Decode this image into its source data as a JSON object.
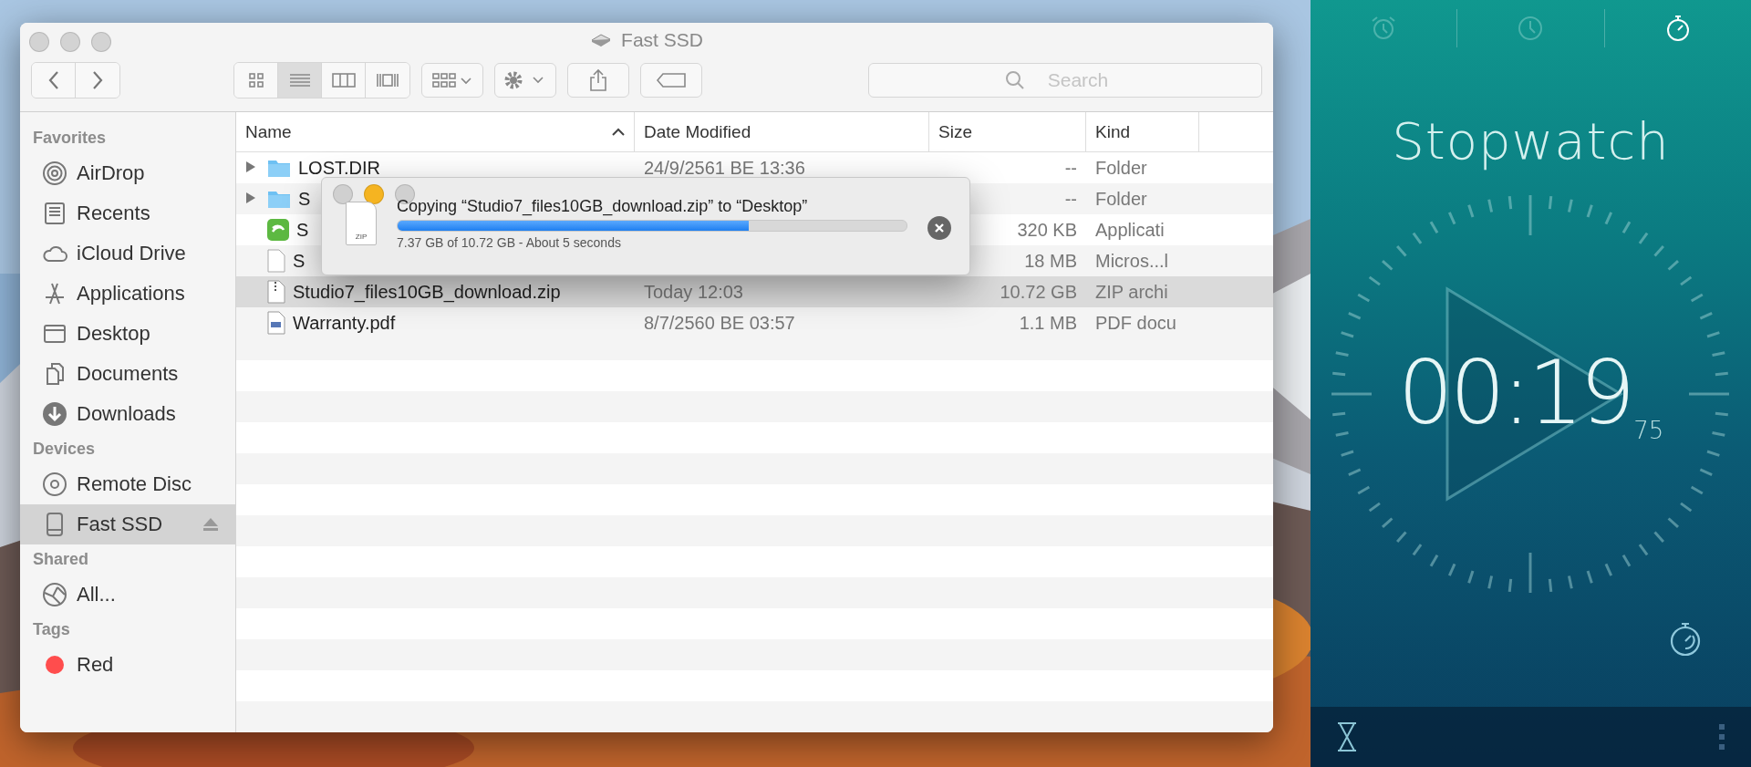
{
  "finder": {
    "title": "Fast SSD",
    "view_modes": [
      {
        "kind": "icons",
        "selected": false
      },
      {
        "kind": "list",
        "selected": true
      },
      {
        "kind": "columns",
        "selected": false
      },
      {
        "kind": "gallery",
        "selected": false
      }
    ],
    "search": {
      "placeholder": "Search"
    },
    "sidebar": [
      {
        "title": "Favorites",
        "items": [
          {
            "label": "AirDrop",
            "kind": "airdrop",
            "selected": false
          },
          {
            "label": "Recents",
            "kind": "recents",
            "selected": false
          },
          {
            "label": "iCloud Drive",
            "kind": "cloud",
            "selected": false
          },
          {
            "label": "Applications",
            "kind": "apps",
            "selected": false
          },
          {
            "label": "Desktop",
            "kind": "desktop",
            "selected": false
          },
          {
            "label": "Documents",
            "kind": "documents",
            "selected": false
          },
          {
            "label": "Downloads",
            "kind": "downloads",
            "selected": false
          }
        ]
      },
      {
        "title": "Devices",
        "items": [
          {
            "label": "Remote Disc",
            "kind": "disc",
            "selected": false
          },
          {
            "label": "Fast SSD",
            "kind": "drive",
            "selected": true,
            "ejectable": true
          }
        ]
      },
      {
        "title": "Shared",
        "items": [
          {
            "label": "All...",
            "kind": "network",
            "selected": false
          }
        ]
      },
      {
        "title": "Tags",
        "items": [
          {
            "label": "Red",
            "kind": "tag",
            "color": "#ff4d4d",
            "selected": false
          }
        ]
      }
    ],
    "columns": [
      {
        "label": "Name",
        "sorted": true
      },
      {
        "label": "Date Modified",
        "sorted": false
      },
      {
        "label": "Size",
        "sorted": false
      },
      {
        "label": "Kind",
        "sorted": false
      }
    ],
    "rows": [
      {
        "kind": "folder",
        "expandable": true,
        "selected": false,
        "name": "LOST.DIR",
        "date": "24/9/2561 BE 13:36",
        "size": "--",
        "file_kind": "Folder"
      },
      {
        "kind": "folder",
        "expandable": true,
        "selected": false,
        "name": "S",
        "size": "--",
        "file_kind": "Folder"
      },
      {
        "kind": "app",
        "expandable": false,
        "selected": false,
        "name": "S",
        "size": "320 KB",
        "file_kind": "Applicati"
      },
      {
        "kind": "document",
        "expandable": false,
        "selected": false,
        "name": "S",
        "size": "18 MB",
        "file_kind": "Micros...l"
      },
      {
        "kind": "zip",
        "expandable": false,
        "selected": true,
        "name": "Studio7_files10GB_download.zip",
        "date": "Today 12:03",
        "size": "10.72 GB",
        "file_kind": "ZIP archi"
      },
      {
        "kind": "pdf",
        "expandable": false,
        "selected": false,
        "name": "Warranty.pdf",
        "date": "8/7/2560 BE 03:57",
        "size": "1.1 MB",
        "file_kind": "PDF docu"
      }
    ],
    "copy_dialog": {
      "file_badge": "ZIP",
      "message": "Copying “Studio7_files10GB_download.zip” to “Desktop”",
      "level": 0.69,
      "status": "7.37 GB of 10.72 GB - About 5 seconds"
    }
  },
  "stopwatch": {
    "tabs": [
      {
        "kind": "alarm",
        "selected": false
      },
      {
        "kind": "clock",
        "selected": false
      },
      {
        "kind": "stopwatch",
        "selected": true
      }
    ],
    "title": "Stopwatch",
    "time": "00:19",
    "hundredths": "75"
  }
}
